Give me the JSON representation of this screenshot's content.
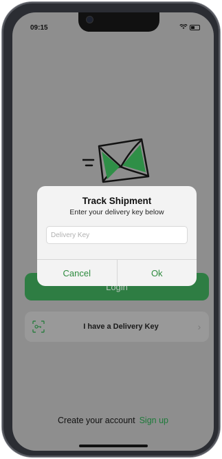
{
  "status_bar": {
    "time": "09:15",
    "signal_icon": "signal-icon",
    "battery_icon": "battery-icon"
  },
  "main": {
    "login_label": "Login",
    "delivery_key_label": "I have a Delivery Key",
    "scan_icon": "scan-key-icon",
    "chevron_icon": "chevron-right-icon",
    "create_account_text": "Create your account",
    "sign_up_label": "Sign up"
  },
  "dialog": {
    "title": "Track Shipment",
    "subtitle": "Enter your delivery key below",
    "input_placeholder": "Delivery Key",
    "input_value": "",
    "cancel_label": "Cancel",
    "ok_label": "Ok"
  },
  "colors": {
    "accent": "#2e7d43",
    "overlay": "#8e8e8e",
    "dialog_action": "#2e8b3e"
  }
}
